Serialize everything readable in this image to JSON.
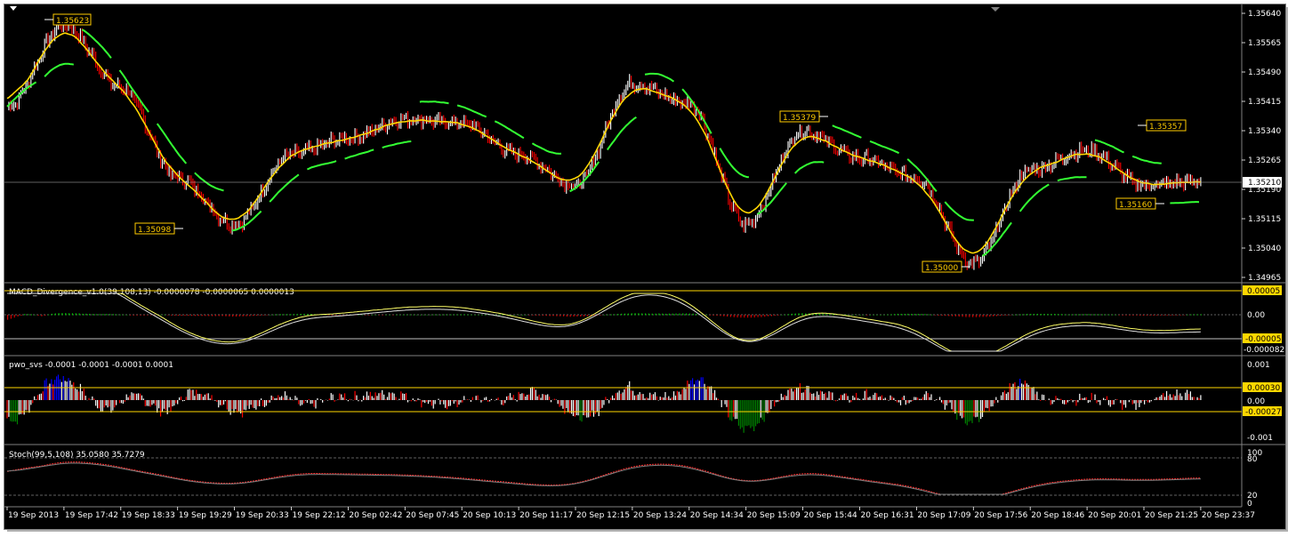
{
  "colors": {
    "background": "#000000",
    "price_candles_up": "#ffffff",
    "price_candles_down": "#ff0000",
    "ma_fast": "#ffd700",
    "ma_slow_green": "#33ff33",
    "label_box": "#ffcc00",
    "stoch_line": "#ff3030",
    "pwo_white": "#ffffff",
    "pwo_red": "#ff0000",
    "pwo_blue": "#0000ff",
    "pwo_green": "#008000"
  },
  "main_axis": {
    "ticks": [
      "1.35640",
      "1.35565",
      "1.35490",
      "1.35415",
      "1.35340",
      "1.35265",
      "1.35190",
      "1.35115",
      "1.35040",
      "1.34965"
    ],
    "current_price": "1.35210"
  },
  "annotations": {
    "high1": "1.35623",
    "low1": "1.35098",
    "high2": "1.35379",
    "low2": "1.35000",
    "high3": "1.35357",
    "low3": "1.35160"
  },
  "macd": {
    "title": "MACD_Divergence_v1.0(39,108,13) -0.0000078 -0.0000065 0.0000013",
    "levels": [
      "0.00005",
      "0.00",
      "-0.00005",
      "-0.000082"
    ]
  },
  "pwo": {
    "title": "pwo_svs -0.0001 -0.0001 -0.0001 0.0001",
    "levels": [
      "0.001",
      "0.00030",
      "0.00",
      "-0.00027",
      "-0.001"
    ]
  },
  "stoch": {
    "title": "Stoch(99,5,108) 35.0580 35.7279",
    "levels": [
      "100",
      "80",
      "20",
      "0"
    ]
  },
  "time_axis": [
    "19 Sep 2013",
    "19 Sep 17:42",
    "19 Sep 18:33",
    "19 Sep 19:29",
    "19 Sep 20:33",
    "19 Sep 22:12",
    "20 Sep 02:42",
    "20 Sep 07:45",
    "20 Sep 10:13",
    "20 Sep 11:17",
    "20 Sep 12:15",
    "20 Sep 13:24",
    "20 Sep 14:34",
    "20 Sep 15:09",
    "20 Sep 15:44",
    "20 Sep 16:31",
    "20 Sep 17:09",
    "20 Sep 17:56",
    "20 Sep 18:46",
    "20 Sep 20:01",
    "20 Sep 21:25",
    "20 Sep 23:37"
  ],
  "chart_data": {
    "type": "line",
    "title": "",
    "xlabel": "",
    "ylabel": "",
    "x": [
      "19 Sep 2013",
      "19 Sep 17:42",
      "19 Sep 18:33",
      "19 Sep 19:29",
      "19 Sep 20:33",
      "19 Sep 22:12",
      "20 Sep 02:42",
      "20 Sep 07:45",
      "20 Sep 10:13",
      "20 Sep 11:17",
      "20 Sep 12:15",
      "20 Sep 13:24",
      "20 Sep 14:34",
      "20 Sep 15:09",
      "20 Sep 15:44",
      "20 Sep 16:31",
      "20 Sep 17:09",
      "20 Sep 17:56",
      "20 Sep 18:46",
      "20 Sep 20:01",
      "20 Sep 21:25",
      "20 Sep 23:37"
    ],
    "series": [
      {
        "values": [
          1.354,
          1.3561,
          1.3545,
          1.3522,
          1.351,
          1.3528,
          1.3532,
          1.3537,
          1.3536,
          1.3528,
          1.352,
          1.3546,
          1.3541,
          1.351,
          1.3534,
          1.3527,
          1.3522,
          1.35,
          1.3524,
          1.3529,
          1.352,
          1.3521
        ]
      }
    ],
    "ylim": [
      1.34965,
      1.3564
    ],
    "grid": false
  }
}
